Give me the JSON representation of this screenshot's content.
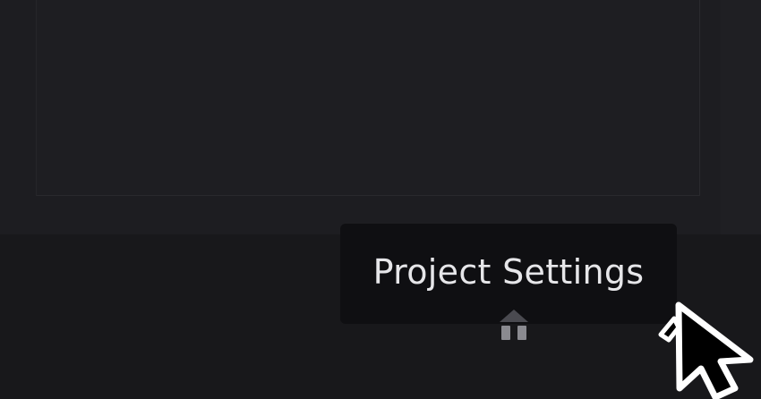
{
  "tooltip": {
    "text": "Project Settings"
  },
  "icons": {
    "project_settings": "house-gear-icon",
    "cursor": "mouse-pointer-icon"
  },
  "colors": {
    "background": "#19191c",
    "tooltip_background": "#0f0f12",
    "tooltip_text": "#e6e6e9"
  }
}
